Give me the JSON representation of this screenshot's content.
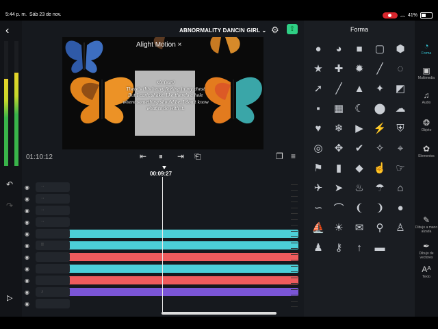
{
  "status_bar": {
    "time": "5:44 p. m.",
    "date": "Sáb 23 de nov.",
    "battery": "41%"
  },
  "header": {
    "project_title": "ABNORMALITY DANCIN GIRL",
    "title_arrow": "⌄"
  },
  "preview": {
    "watermark": "Alight Motion ×",
    "lyric_lines": [
      "x/x (sun)",
      "There's this heavy feeling in my chest",
      "But I can't shake, like there's a hole",
      "where something should be, I don't know",
      "what to do with it."
    ]
  },
  "transport": {
    "current_time": "01:10:12",
    "playhead_time": "00:09:27"
  },
  "timeline": {
    "layers": [
      {
        "thumb": "··",
        "color": ""
      },
      {
        "thumb": "··",
        "color": ""
      },
      {
        "thumb": "··",
        "color": ""
      },
      {
        "thumb": "··",
        "color": ""
      },
      {
        "thumb": "",
        "color": "#4ccfd8"
      },
      {
        "thumb": "!!",
        "color": "#4ccfd8"
      },
      {
        "thumb": "",
        "color": "#ef5b5d"
      },
      {
        "thumb": "",
        "color": "#4ccfd8"
      },
      {
        "thumb": "",
        "color": "#ef5b5d"
      },
      {
        "thumb": "♪",
        "color": "#7a55d6"
      },
      {
        "thumb": "",
        "color": ""
      }
    ]
  },
  "shapes_panel": {
    "title": "Forma",
    "shapes": [
      "circle",
      "pie",
      "square",
      "rounded-square",
      "hexagon",
      "star",
      "plus",
      "star-round",
      "line",
      "arc",
      "arrow-diagonal",
      "pencil-line",
      "triangle-cone",
      "square-burst",
      "square-notch",
      "speech-bubble",
      "stamp",
      "crescent",
      "drop",
      "cloud",
      "heart",
      "snowflake",
      "play",
      "lightning",
      "shield",
      "spiral",
      "puzzle",
      "check",
      "sparkle",
      "pin",
      "flag",
      "bookmark",
      "diamond",
      "thumbs-up",
      "pointing-hand",
      "airplane",
      "paper-plane",
      "fire",
      "umbrella",
      "house",
      "mustache",
      "eyebrow",
      "laurel-left",
      "laurel-right",
      "bomb",
      "sailboat",
      "sun",
      "envelope",
      "magnifier",
      "person",
      "person-small",
      "key",
      "rocket",
      "car"
    ]
  },
  "right_nav": {
    "items": [
      {
        "label": "Forma",
        "icon": "shapes-icon",
        "active": true
      },
      {
        "label": "Multimedia",
        "icon": "image-icon"
      },
      {
        "label": "Audio",
        "icon": "music-icon"
      },
      {
        "label": "Objeto",
        "icon": "object-icon"
      },
      {
        "label": "Elementos",
        "icon": "elements-icon"
      },
      {
        "label": "Dibujo a mano alzada",
        "icon": "brush-icon"
      },
      {
        "label": "Dibujo de vectores",
        "icon": "vector-pen-icon"
      },
      {
        "label": "Texto",
        "icon": "text-icon"
      }
    ]
  },
  "colors": {
    "accent": "#35c8d8",
    "export": "#2fcf85",
    "record": "#d8262d"
  }
}
